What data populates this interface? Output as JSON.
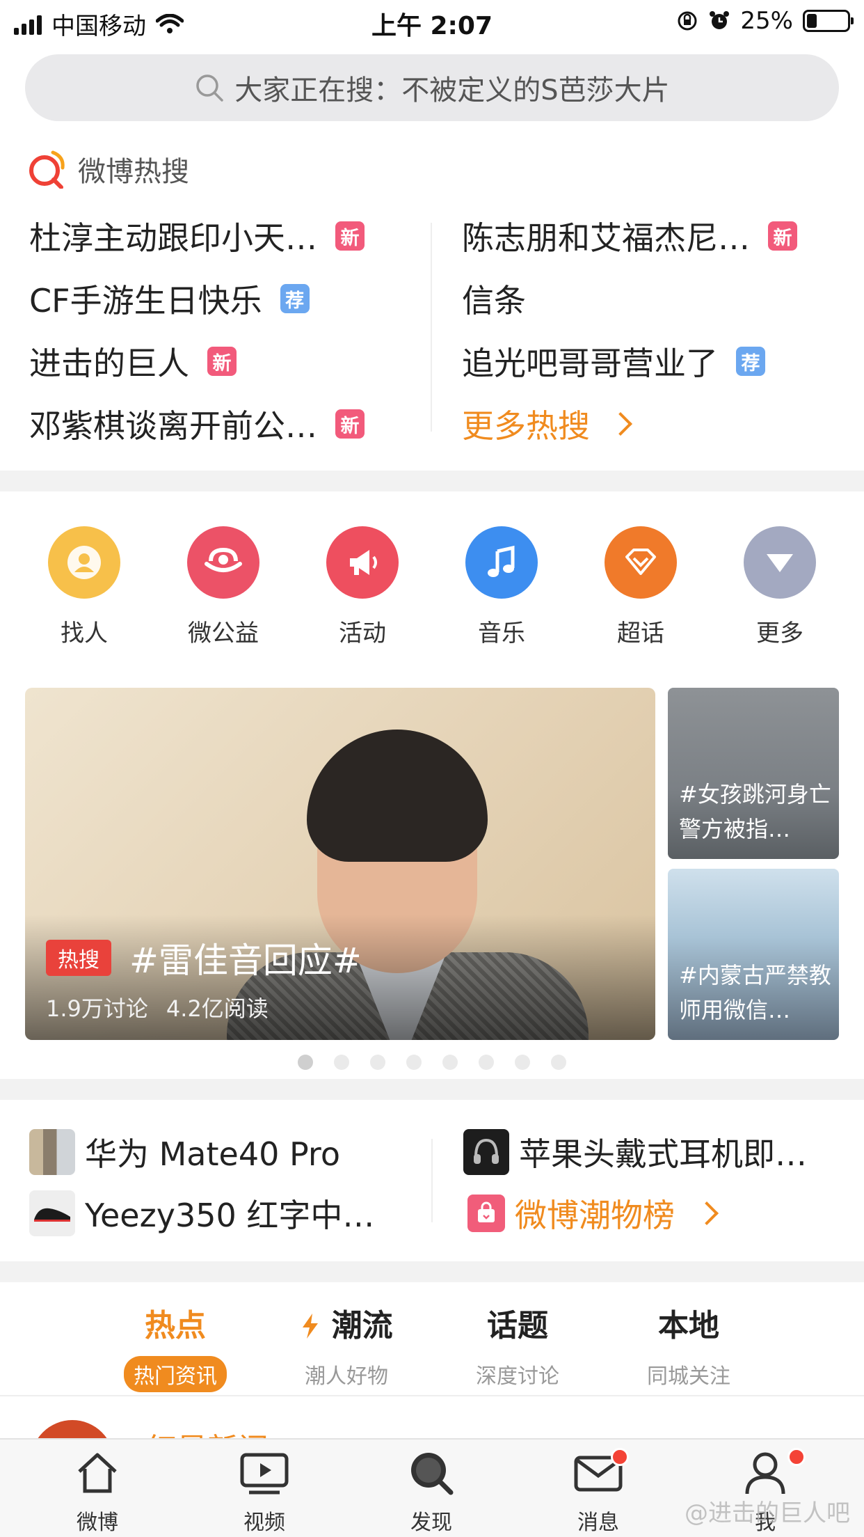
{
  "status_bar": {
    "carrier": "中国移动",
    "time": "上午 2:07",
    "battery": "25%",
    "battery_level": 0.25
  },
  "search": {
    "placeholder": "大家正在搜：不被定义的S芭莎大片"
  },
  "hot_search": {
    "title": "微博热搜",
    "left": [
      {
        "text": "杜淳主动跟印小天…",
        "tag": "新"
      },
      {
        "text": "CF手游生日快乐",
        "tag": "荐"
      },
      {
        "text": "进击的巨人",
        "tag": "新"
      },
      {
        "text": "邓紫棋谈离开前公…",
        "tag": "新"
      }
    ],
    "right": [
      {
        "text": "陈志朋和艾福杰尼…",
        "tag": "新"
      },
      {
        "text": "信条",
        "tag": ""
      },
      {
        "text": "追光吧哥哥营业了",
        "tag": "荐"
      }
    ],
    "more": "更多热搜"
  },
  "shortcuts": [
    {
      "label": "找人",
      "icon": "person-icon",
      "color": "#f7c04a"
    },
    {
      "label": "微公益",
      "icon": "charity-icon",
      "color": "#ec5267"
    },
    {
      "label": "活动",
      "icon": "megaphone-icon",
      "color": "#ee4f5f"
    },
    {
      "label": "音乐",
      "icon": "music-icon",
      "color": "#3d8ef0"
    },
    {
      "label": "超话",
      "icon": "diamond-icon",
      "color": "#f07a2a"
    },
    {
      "label": "更多",
      "icon": "more-down-icon",
      "color": "#a3a9c1"
    }
  ],
  "banner": {
    "badge": "热搜",
    "title": "#雷佳音回应#",
    "discussions": "1.9万讨论",
    "reads": "4.2亿阅读",
    "side_cards": [
      {
        "caption": "#女孩跳河身亡警方被指…"
      },
      {
        "caption": "#内蒙古严禁教师用微信…"
      }
    ],
    "page_count": 8,
    "active_page": 1
  },
  "products": {
    "items": [
      {
        "text": "华为 Mate40 Pro"
      },
      {
        "text": "苹果头戴式耳机即…"
      },
      {
        "text": "Yeezy350 红字中…"
      }
    ],
    "chart_link": "微博潮物榜"
  },
  "tabs": [
    {
      "title": "热点",
      "sub": "热门资讯"
    },
    {
      "title": "潮流",
      "sub": "潮人好物"
    },
    {
      "title": "话题",
      "sub": "深度讨论"
    },
    {
      "title": "本地",
      "sub": "同城关注"
    }
  ],
  "feed_peek": {
    "text": "红星新闻"
  },
  "nav": [
    {
      "label": "微博"
    },
    {
      "label": "视频"
    },
    {
      "label": "发现"
    },
    {
      "label": "消息"
    },
    {
      "label": "我"
    }
  ],
  "watermark": "@进击的巨人吧",
  "colors": {
    "accent": "#f08b1f",
    "new_tag": "#f25a7b",
    "rec_tag": "#6ba7f0",
    "hot_badge": "#e9423b"
  }
}
